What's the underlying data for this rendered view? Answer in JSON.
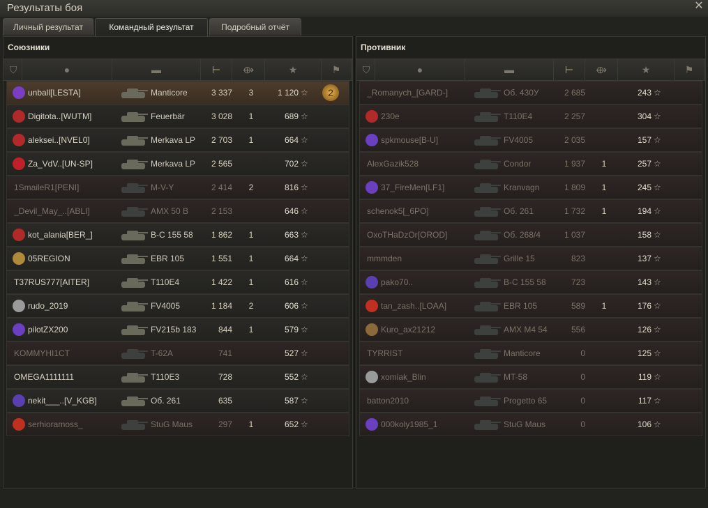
{
  "window": {
    "title": "Результаты боя",
    "close_glyph": "✕"
  },
  "tabs": [
    {
      "label": "Личный результат"
    },
    {
      "label": "Командный результат"
    },
    {
      "label": "Подробный отчёт"
    }
  ],
  "allies": {
    "title": "Союзники",
    "rows": [
      {
        "name": "unball[LESTA]",
        "tank": "Manticore",
        "damage": "3 337",
        "kills": "3",
        "xp": "1 120",
        "state": "me",
        "badge_color": "#7a3fc0",
        "medal": "2"
      },
      {
        "name": "Digitota..[WUTM]",
        "tank": "Feuerbär",
        "damage": "3 028",
        "kills": "1",
        "xp": "689",
        "state": "alive",
        "badge_color": "#b02a2a"
      },
      {
        "name": "aleksei..[NVEL0]",
        "tank": "Merkava LP",
        "damage": "2 703",
        "kills": "1",
        "xp": "664",
        "state": "alive",
        "badge_color": "#b02a2a"
      },
      {
        "name": "Za_VdV..[UN-SP]",
        "tank": "Merkava LP",
        "damage": "2 565",
        "kills": "",
        "xp": "702",
        "state": "alive",
        "badge_color": "#c0202a"
      },
      {
        "name": "1SmaileR1[PENI]",
        "tank": "M-V-Y",
        "damage": "2 414",
        "kills": "2",
        "xp": "816",
        "state": "dead",
        "badge_color": ""
      },
      {
        "name": "_Devil_May_..[ABLI]",
        "tank": "AMX 50 B",
        "damage": "2 153",
        "kills": "",
        "xp": "646",
        "state": "dead",
        "badge_color": ""
      },
      {
        "name": "kot_alania[BER_]",
        "tank": "B-C 155 58",
        "damage": "1 862",
        "kills": "1",
        "xp": "663",
        "state": "alive",
        "badge_color": "#b02a2a"
      },
      {
        "name": "05REGION",
        "tank": "EBR 105",
        "damage": "1 551",
        "kills": "1",
        "xp": "664",
        "state": "alive",
        "badge_color": "#b08a3a"
      },
      {
        "name": "T37RUS777[AITER]",
        "tank": "T110E4",
        "damage": "1 422",
        "kills": "1",
        "xp": "616",
        "state": "alive",
        "badge_color": ""
      },
      {
        "name": "rudo_2019",
        "tank": "FV4005",
        "damage": "1 184",
        "kills": "2",
        "xp": "606",
        "state": "alive",
        "badge_color": "#9a9a9a"
      },
      {
        "name": "pilotZX200",
        "tank": "FV215b 183",
        "damage": "844",
        "kills": "1",
        "xp": "579",
        "state": "alive",
        "badge_color": "#6a3fc0"
      },
      {
        "name": "KOMMYHI1CT",
        "tank": "T-62A",
        "damage": "741",
        "kills": "",
        "xp": "527",
        "state": "dead",
        "badge_color": ""
      },
      {
        "name": "OMEGA1111111",
        "tank": "T110E3",
        "damage": "728",
        "kills": "",
        "xp": "552",
        "state": "alive",
        "badge_color": ""
      },
      {
        "name": "nekit___..[V_KGB]",
        "tank": "Об. 261",
        "damage": "635",
        "kills": "",
        "xp": "587",
        "state": "alive",
        "badge_color": "#5a3fb0"
      },
      {
        "name": "serhioramoss_",
        "tank": "StuG Maus",
        "damage": "297",
        "kills": "1",
        "xp": "652",
        "state": "dead",
        "badge_color": "#c03020"
      }
    ]
  },
  "enemies": {
    "title": "Противник",
    "rows": [
      {
        "name": "_Romanych_[GARD-]",
        "tank": "Об. 430У",
        "damage": "2 685",
        "kills": "",
        "xp": "243",
        "state": "dead",
        "badge_color": ""
      },
      {
        "name": "230e",
        "tank": "T110E4",
        "damage": "2 257",
        "kills": "",
        "xp": "304",
        "state": "dead",
        "badge_color": "#b02a2a"
      },
      {
        "name": "spkmouse[B-U]",
        "tank": "FV4005",
        "damage": "2 035",
        "kills": "",
        "xp": "157",
        "state": "dead",
        "badge_color": "#6a3fc0"
      },
      {
        "name": "AlexGazik528",
        "tank": "Condor",
        "damage": "1 937",
        "kills": "1",
        "xp": "257",
        "state": "dead",
        "badge_color": ""
      },
      {
        "name": "37_FireMen[LF1]",
        "tank": "Kranvagn",
        "damage": "1 809",
        "kills": "1",
        "xp": "245",
        "state": "dead",
        "badge_color": "#6a3fc0"
      },
      {
        "name": "schenok5[_6PO]",
        "tank": "Об. 261",
        "damage": "1 732",
        "kills": "1",
        "xp": "194",
        "state": "dead",
        "badge_color": ""
      },
      {
        "name": "OxoTHaDzOr[OROD]",
        "tank": "Об. 268/4",
        "damage": "1 037",
        "kills": "",
        "xp": "158",
        "state": "dead",
        "badge_color": ""
      },
      {
        "name": "mmmden",
        "tank": "Grille 15",
        "damage": "823",
        "kills": "",
        "xp": "137",
        "state": "dead",
        "badge_color": ""
      },
      {
        "name": "pako70..",
        "tank": "B-C 155 58",
        "damage": "723",
        "kills": "",
        "xp": "143",
        "state": "dead",
        "badge_color": "#5a3fb0"
      },
      {
        "name": "tan_zash..[LOAA]",
        "tank": "EBR 105",
        "damage": "589",
        "kills": "1",
        "xp": "176",
        "state": "dead",
        "badge_color": "#c03020"
      },
      {
        "name": "Kuro_ax21212",
        "tank": "AMX M4 54",
        "damage": "556",
        "kills": "",
        "xp": "126",
        "state": "dead",
        "badge_color": "#8a6a3a"
      },
      {
        "name": "TYRRIST",
        "tank": "Manticore",
        "damage": "0",
        "kills": "",
        "xp": "125",
        "state": "dead",
        "badge_color": ""
      },
      {
        "name": "xomiak_Blin",
        "tank": "MT-58",
        "damage": "0",
        "kills": "",
        "xp": "119",
        "state": "dead",
        "badge_color": "#9a9a9a"
      },
      {
        "name": "batton2010",
        "tank": "Progetto 65",
        "damage": "0",
        "kills": "",
        "xp": "117",
        "state": "dead",
        "badge_color": ""
      },
      {
        "name": "000koly1985_1",
        "tank": "StuG Maus",
        "damage": "0",
        "kills": "",
        "xp": "106",
        "state": "dead",
        "badge_color": "#6a3fc0"
      }
    ]
  },
  "star_glyph": "☆",
  "header_icons": [
    "squad-icon",
    "player-icon",
    "tank-icon",
    "damage-icon",
    "kills-icon",
    "xp-star-icon",
    "medal-icon"
  ]
}
